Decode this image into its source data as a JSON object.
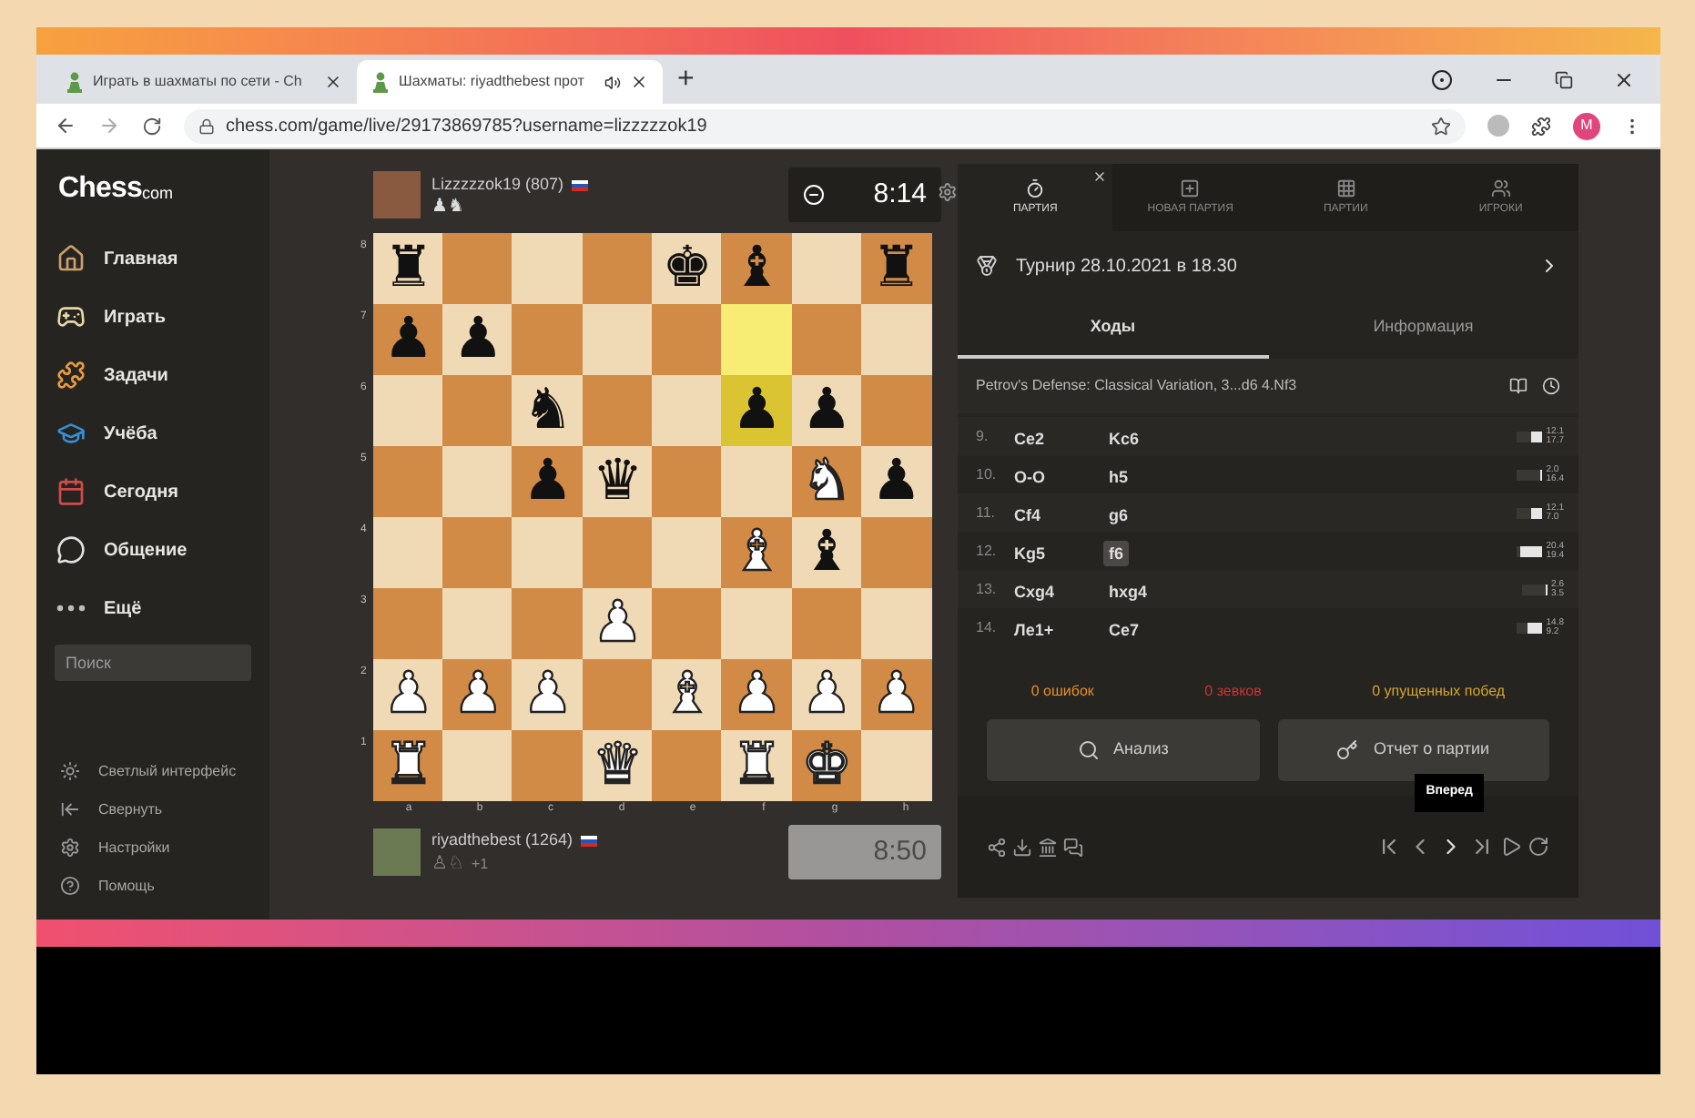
{
  "browser": {
    "tabs": [
      {
        "title": "Играть в шахматы по сети - Ch",
        "selected": false,
        "audio": false
      },
      {
        "title": "Шахматы: riyadthebest прот",
        "selected": true,
        "audio": true
      }
    ],
    "new_tab": "+",
    "address": "chess.com/game/live/29173869785?username=lizzzzzok19",
    "profile": "M"
  },
  "sidebar": {
    "logo_main": "Chess",
    "logo_suffix": "com",
    "items": [
      {
        "label": "Главная"
      },
      {
        "label": "Играть"
      },
      {
        "label": "Задачи"
      },
      {
        "label": "Учёба"
      },
      {
        "label": "Сегодня"
      },
      {
        "label": "Общение"
      },
      {
        "label": "Ещё"
      }
    ],
    "search": {
      "placeholder": "Поиск"
    },
    "footer": [
      {
        "label": "Светлый интерфейс"
      },
      {
        "label": "Свернуть"
      },
      {
        "label": "Настройки"
      },
      {
        "label": "Помощь"
      }
    ]
  },
  "top_player": {
    "name": "Lizzzzzok19 (807)",
    "captured": "♟♞",
    "clock": "8:14",
    "active": true
  },
  "bottom_player": {
    "name": "riyadthebest (1264)",
    "captured": "♙♘",
    "advantage": "+1",
    "clock": "8:50",
    "active": false
  },
  "board": {
    "ranks": [
      "8",
      "7",
      "6",
      "5",
      "4",
      "3",
      "2",
      "1"
    ],
    "files": [
      "a",
      "b",
      "c",
      "d",
      "e",
      "f",
      "g",
      "h"
    ],
    "rows": [
      [
        {
          "piece": "♜",
          "kind": "black",
          "highlighted": false
        },
        {
          "highlighted": false
        },
        {
          "highlighted": false
        },
        {
          "highlighted": false
        },
        {
          "piece": "♚",
          "kind": "black",
          "highlighted": false
        },
        {
          "piece": "♝",
          "kind": "black",
          "highlighted": false
        },
        {
          "highlighted": false
        },
        {
          "piece": "♜",
          "kind": "black",
          "highlighted": false
        }
      ],
      [
        {
          "piece": "♟",
          "kind": "black",
          "highlighted": false
        },
        {
          "piece": "♟",
          "kind": "black",
          "highlighted": false
        },
        {
          "highlighted": false
        },
        {
          "highlighted": false
        },
        {
          "highlighted": false
        },
        {
          "highlighted": true
        },
        {
          "highlighted": false
        },
        {
          "highlighted": false
        }
      ],
      [
        {
          "highlighted": false
        },
        {
          "highlighted": false
        },
        {
          "piece": "♞",
          "kind": "black",
          "highlighted": false
        },
        {
          "highlighted": false
        },
        {
          "highlighted": false
        },
        {
          "piece": "♟",
          "kind": "black",
          "highlighted": true
        },
        {
          "piece": "♟",
          "kind": "black",
          "highlighted": false
        },
        {
          "highlighted": false
        }
      ],
      [
        {
          "highlighted": false
        },
        {
          "highlighted": false
        },
        {
          "piece": "♟",
          "kind": "black",
          "highlighted": false
        },
        {
          "piece": "♛",
          "kind": "black",
          "highlighted": false
        },
        {
          "highlighted": false
        },
        {
          "highlighted": false
        },
        {
          "piece": "♞",
          "kind": "white",
          "highlighted": false
        },
        {
          "piece": "♟",
          "kind": "black",
          "highlighted": false
        }
      ],
      [
        {
          "highlighted": false
        },
        {
          "highlighted": false
        },
        {
          "highlighted": false
        },
        {
          "highlighted": false
        },
        {
          "highlighted": false
        },
        {
          "piece": "♝",
          "kind": "white",
          "highlighted": false
        },
        {
          "piece": "♝",
          "kind": "black",
          "highlighted": false
        },
        {
          "highlighted": false
        }
      ],
      [
        {
          "highlighted": false
        },
        {
          "highlighted": false
        },
        {
          "highlighted": false
        },
        {
          "piece": "♟",
          "kind": "white",
          "highlighted": false
        },
        {
          "highlighted": false
        },
        {
          "highlighted": false
        },
        {
          "highlighted": false
        },
        {
          "highlighted": false
        }
      ],
      [
        {
          "piece": "♟",
          "kind": "white",
          "highlighted": false
        },
        {
          "piece": "♟",
          "kind": "white",
          "highlighted": false
        },
        {
          "piece": "♟",
          "kind": "white",
          "highlighted": false
        },
        {
          "highlighted": false
        },
        {
          "piece": "♝",
          "kind": "white",
          "highlighted": false
        },
        {
          "piece": "♟",
          "kind": "white",
          "highlighted": false
        },
        {
          "piece": "♟",
          "kind": "white",
          "highlighted": false
        },
        {
          "piece": "♟",
          "kind": "white",
          "highlighted": false
        }
      ],
      [
        {
          "piece": "♜",
          "kind": "white",
          "highlighted": false
        },
        {
          "highlighted": false
        },
        {
          "highlighted": false
        },
        {
          "piece": "♛",
          "kind": "white",
          "highlighted": false
        },
        {
          "highlighted": false
        },
        {
          "piece": "♜",
          "kind": "white",
          "highlighted": false
        },
        {
          "piece": "♚",
          "kind": "white",
          "highlighted": false
        },
        {
          "highlighted": false
        }
      ]
    ]
  },
  "panel": {
    "tabs": [
      {
        "label": "ПАРТИЯ",
        "selected": true
      },
      {
        "label": "НОВАЯ ПАРТИЯ",
        "selected": false
      },
      {
        "label": "ПАРТИИ",
        "selected": false
      },
      {
        "label": "ИГРОКИ",
        "selected": false
      }
    ],
    "tournament": "Турнир 28.10.2021 в 18.30",
    "subtabs": [
      {
        "label": "Ходы",
        "selected": true
      },
      {
        "label": "Информация",
        "selected": false
      }
    ],
    "opening": "Petrov's Defense: Classical Variation, 3...d6 4.Nf3",
    "moves": [
      {
        "number": "9.",
        "white": {
          "text": "Ce2",
          "selected": false
        },
        "black": {
          "text": "Kc6",
          "selected": false
        },
        "time_white": "12.1",
        "time_black": "17.7",
        "level": 0.45
      },
      {
        "number": "10.",
        "white": {
          "text": "O-O",
          "selected": false
        },
        "black": {
          "text": "h5",
          "selected": false
        },
        "time_white": "2.0",
        "time_black": "16.4",
        "level": 0.1
      },
      {
        "number": "11.",
        "white": {
          "text": "Cf4",
          "selected": false
        },
        "black": {
          "text": "g6",
          "selected": false
        },
        "time_white": "12.1",
        "time_black": "7.0",
        "level": 0.45
      },
      {
        "number": "12.",
        "white": {
          "text": "Kg5",
          "selected": false
        },
        "black": {
          "text": "f6",
          "selected": true
        },
        "time_white": "20.4",
        "time_black": "19.4",
        "level": 0.85
      },
      {
        "number": "13.",
        "white": {
          "text": "Cxg4",
          "selected": false
        },
        "black": {
          "text": "hxg4",
          "selected": false
        },
        "time_white": "2.6",
        "time_black": "3.5",
        "level": 0.1
      },
      {
        "number": "14.",
        "white": {
          "text": "Ле1+",
          "selected": false
        },
        "black": {
          "text": "Ce7",
          "selected": false
        },
        "time_white": "14.8",
        "time_black": "9.2",
        "level": 0.6
      }
    ],
    "stats": [
      {
        "text": "0 ошибок",
        "color": "#e58f2a"
      },
      {
        "text": "0 зевков",
        "color": "#ca3431"
      },
      {
        "text": "0 упущенных побед",
        "color": "#d6a52a"
      }
    ],
    "buttons": [
      {
        "label": "Анализ",
        "kind": "analysis"
      },
      {
        "label": "Отчет о партии",
        "kind": "report"
      }
    ],
    "tooltip": "Вперед"
  }
}
